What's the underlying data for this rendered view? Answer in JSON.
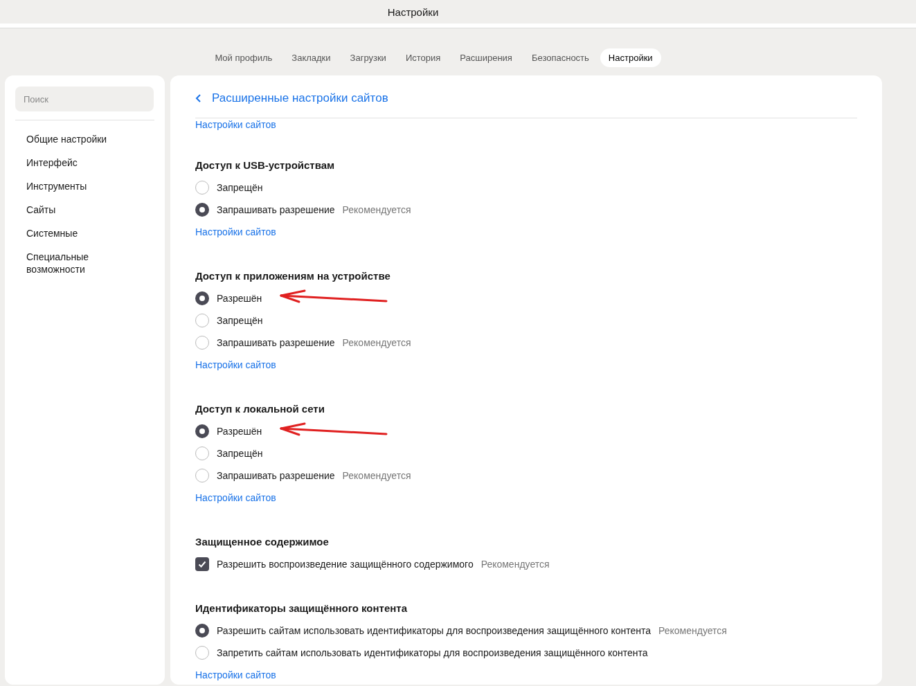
{
  "window": {
    "title": "Настройки"
  },
  "tabs": [
    {
      "label": "Мой профиль",
      "selected": false
    },
    {
      "label": "Закладки",
      "selected": false
    },
    {
      "label": "Загрузки",
      "selected": false
    },
    {
      "label": "История",
      "selected": false
    },
    {
      "label": "Расширения",
      "selected": false
    },
    {
      "label": "Безопасность",
      "selected": false
    },
    {
      "label": "Настройки",
      "selected": true
    }
  ],
  "sidebar": {
    "search": {
      "placeholder": "Поиск"
    },
    "items": [
      "Общие настройки",
      "Интерфейс",
      "Инструменты",
      "Сайты",
      "Системные",
      "Специальные возможности"
    ]
  },
  "page": {
    "title": "Расширенные настройки сайтов",
    "top_link": "Настройки сайтов",
    "sections": [
      {
        "title": "Доступ к USB-устройствам",
        "kind": "radio",
        "options": [
          {
            "label": "Запрещён",
            "selected": false
          },
          {
            "label": "Запрашивать разрешение",
            "note": "Рекомендуется",
            "selected": true
          }
        ],
        "link": "Настройки сайтов"
      },
      {
        "title": "Доступ к приложениям на устройстве",
        "kind": "radio",
        "options": [
          {
            "label": "Разрешён",
            "selected": true,
            "arrow": true
          },
          {
            "label": "Запрещён",
            "selected": false
          },
          {
            "label": "Запрашивать разрешение",
            "note": "Рекомендуется",
            "selected": false
          }
        ],
        "link": "Настройки сайтов"
      },
      {
        "title": "Доступ к локальной сети",
        "kind": "radio",
        "options": [
          {
            "label": "Разрешён",
            "selected": true,
            "arrow": true
          },
          {
            "label": "Запрещён",
            "selected": false
          },
          {
            "label": "Запрашивать разрешение",
            "note": "Рекомендуется",
            "selected": false
          }
        ],
        "link": "Настройки сайтов"
      },
      {
        "title": "Защищенное содержимое",
        "kind": "checkbox",
        "options": [
          {
            "label": "Разрешить воспроизведение защищённого содержимого",
            "note": "Рекомендуется",
            "checked": true
          }
        ]
      },
      {
        "title": "Идентификаторы защищённого контента",
        "kind": "radio",
        "options": [
          {
            "label": "Разрешить сайтам использовать идентификаторы для воспроизведения защищённого контента",
            "note": "Рекомендуется",
            "selected": true
          },
          {
            "label": "Запретить сайтам использовать идентификаторы для воспроизведения защищённого контента",
            "selected": false
          }
        ],
        "link": "Настройки сайтов"
      }
    ]
  }
}
